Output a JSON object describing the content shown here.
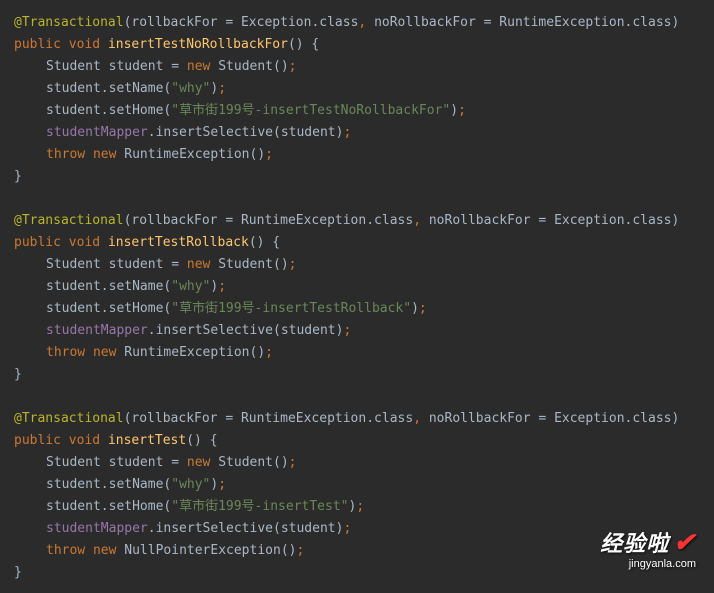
{
  "code": {
    "block1": {
      "annotation_name": "@Transactional",
      "param1_name": "rollbackFor",
      "param1_value": "Exception",
      "param2_name": "noRollbackFor",
      "param2_value": "RuntimeException",
      "class_kw": ".class",
      "modifier1": "public",
      "modifier2": "void",
      "method_name": "insertTestNoRollbackFor",
      "type_student": "Student",
      "var_student": "student",
      "new_kw": "new",
      "ctor": "Student",
      "set_name": "setName",
      "name_arg": "\"why\"",
      "set_home": "setHome",
      "home_arg": "\"草市街199号-insertTestNoRollbackFor\"",
      "mapper": "studentMapper",
      "insert_method": "insertSelective",
      "throw_kw": "throw",
      "exc_type": "RuntimeException"
    },
    "block2": {
      "annotation_name": "@Transactional",
      "param1_name": "rollbackFor",
      "param1_value": "RuntimeException",
      "param2_name": "noRollbackFor",
      "param2_value": "Exception",
      "class_kw": ".class",
      "modifier1": "public",
      "modifier2": "void",
      "method_name": "insertTestRollback",
      "type_student": "Student",
      "var_student": "student",
      "new_kw": "new",
      "ctor": "Student",
      "set_name": "setName",
      "name_arg": "\"why\"",
      "set_home": "setHome",
      "home_arg": "\"草市街199号-insertTestRollback\"",
      "mapper": "studentMapper",
      "insert_method": "insertSelective",
      "throw_kw": "throw",
      "exc_type": "RuntimeException"
    },
    "block3": {
      "annotation_name": "@Transactional",
      "param1_name": "rollbackFor",
      "param1_value": "RuntimeException",
      "param2_name": "noRollbackFor",
      "param2_value": "Exception",
      "class_kw": ".class",
      "modifier1": "public",
      "modifier2": "void",
      "method_name": "insertTest",
      "type_student": "Student",
      "var_student": "student",
      "new_kw": "new",
      "ctor": "Student",
      "set_name": "setName",
      "name_arg": "\"why\"",
      "set_home": "setHome",
      "home_arg": "\"草市街199号-insertTest\"",
      "mapper": "studentMapper",
      "insert_method": "insertSelective",
      "throw_kw": "throw",
      "exc_type": "NullPointerException"
    }
  },
  "watermark": {
    "main": "经验啦",
    "sub": "jingyanla.com"
  }
}
